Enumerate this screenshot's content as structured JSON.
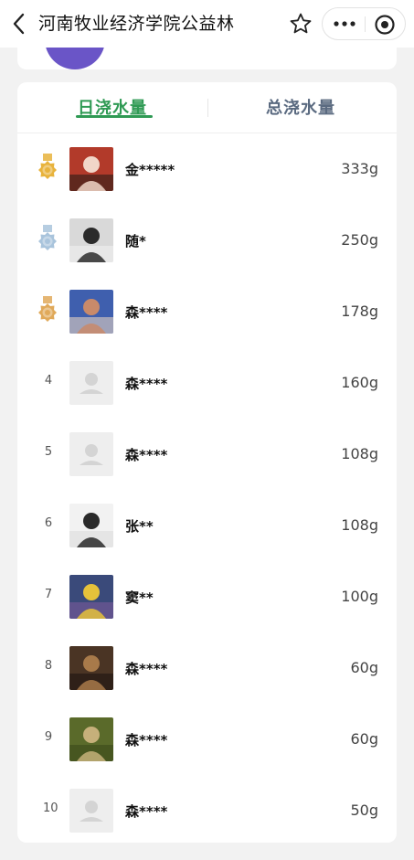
{
  "header": {
    "title": "河南牧业经济学院公益林",
    "icons": [
      "back-icon",
      "star-icon",
      "more-icon",
      "target-icon"
    ]
  },
  "tabs": [
    {
      "label": "日浇水量",
      "active": true
    },
    {
      "label": "总浇水量",
      "active": false
    }
  ],
  "colors": {
    "accent_green": "#2f9a54",
    "inactive_tab": "#5a6a80",
    "medal_gold": "#e8b33c",
    "medal_silver": "#a9c4dc",
    "medal_bronze": "#e0a95a"
  },
  "ranking": [
    {
      "rank": "1",
      "medal": "gold",
      "name": "金*****",
      "amount": "333g",
      "avatar": "photo"
    },
    {
      "rank": "2",
      "medal": "silver",
      "name": "随*",
      "amount": "250g",
      "avatar": "photo"
    },
    {
      "rank": "3",
      "medal": "bronze",
      "name": "森****",
      "amount": "178g",
      "avatar": "photo"
    },
    {
      "rank": "4",
      "medal": "",
      "name": "森****",
      "amount": "160g",
      "avatar": "placeholder"
    },
    {
      "rank": "5",
      "medal": "",
      "name": "森****",
      "amount": "108g",
      "avatar": "placeholder"
    },
    {
      "rank": "6",
      "medal": "",
      "name": "张**",
      "amount": "108g",
      "avatar": "photo"
    },
    {
      "rank": "7",
      "medal": "",
      "name": "窦**",
      "amount": "100g",
      "avatar": "photo"
    },
    {
      "rank": "8",
      "medal": "",
      "name": "森****",
      "amount": "60g",
      "avatar": "photo"
    },
    {
      "rank": "9",
      "medal": "",
      "name": "森****",
      "amount": "60g",
      "avatar": "photo"
    },
    {
      "rank": "10",
      "medal": "",
      "name": "森****",
      "amount": "50g",
      "avatar": "placeholder"
    }
  ]
}
